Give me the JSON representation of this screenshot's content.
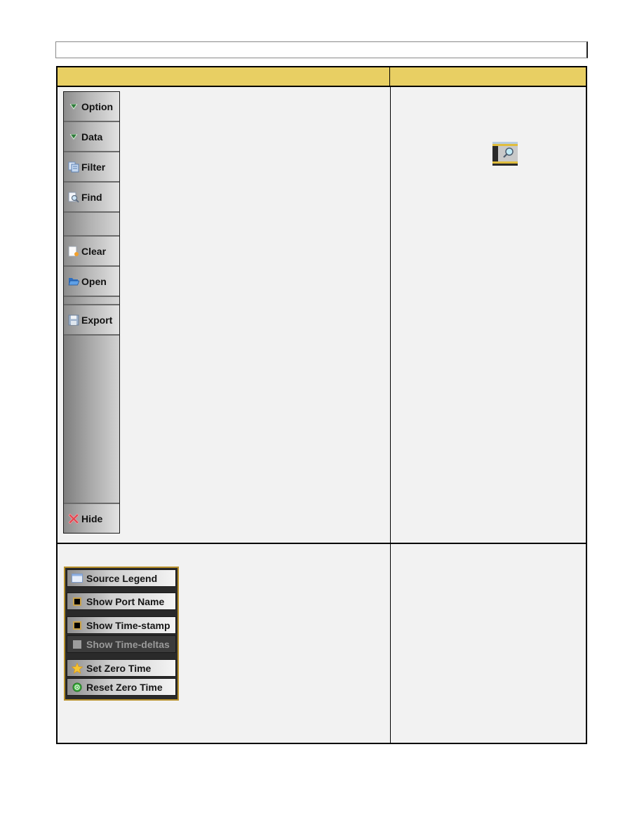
{
  "title_bar": {
    "text": ""
  },
  "table": {
    "headers": [
      "",
      ""
    ],
    "rows": [
      {
        "description": "",
        "note": ""
      },
      {
        "description": "",
        "note": ""
      }
    ]
  },
  "toolbar": {
    "items": [
      {
        "label": "Option",
        "icon": "triangle-down-icon"
      },
      {
        "label": "Data",
        "icon": "triangle-down-icon"
      },
      {
        "label": "Filter",
        "icon": "filter-icon"
      },
      {
        "label": "Find",
        "icon": "find-icon"
      },
      {
        "label": "Clear",
        "icon": "clear-icon"
      },
      {
        "label": "Open",
        "icon": "folder-open-icon"
      },
      {
        "label": "Export",
        "icon": "save-icon"
      },
      {
        "label": "Hide",
        "icon": "close-x-icon"
      }
    ]
  },
  "magnifier_tile": {
    "icon": "magnifier-icon"
  },
  "context_menu": {
    "items": [
      {
        "label": "Source Legend",
        "icon": "legend-icon",
        "enabled": true
      },
      {
        "label": "Show Port Name",
        "icon": "checkbox",
        "checked": false,
        "enabled": true
      },
      {
        "label": "Show Time-stamp",
        "icon": "checkbox",
        "checked": false,
        "enabled": true
      },
      {
        "label": "Show Time-deltas",
        "icon": "checkbox",
        "checked": false,
        "enabled": false
      },
      {
        "label": "Set Zero Time",
        "icon": "star-icon",
        "enabled": true
      },
      {
        "label": "Reset Zero Time",
        "icon": "reset-circle-icon",
        "enabled": true
      }
    ]
  },
  "colors": {
    "header_fill": "#e8cf63",
    "cell_fill": "#f2f2f2",
    "menu_border": "#b8912c"
  }
}
